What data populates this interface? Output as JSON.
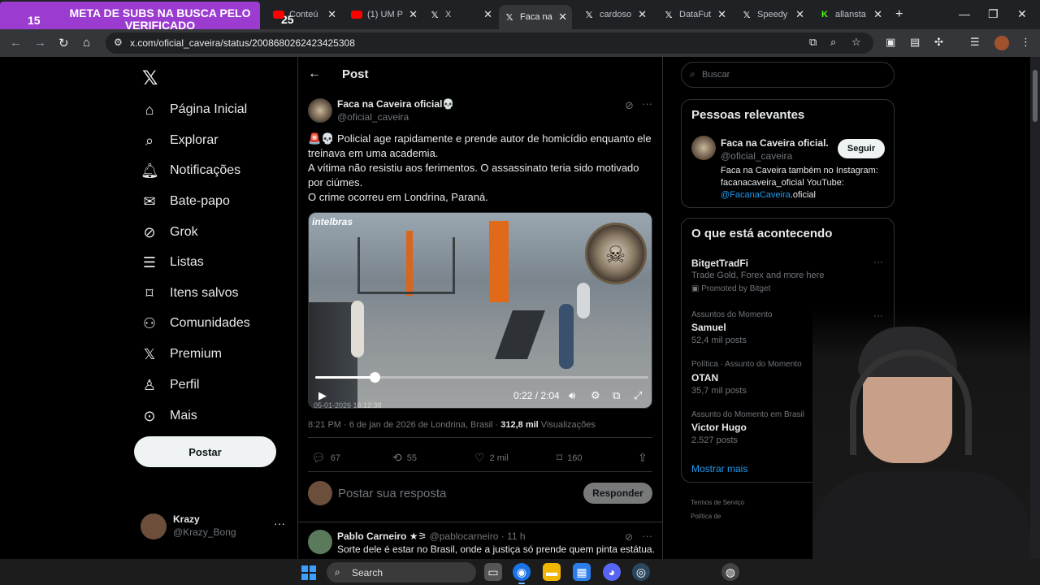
{
  "overlay": {
    "counter_left": "15",
    "banner": "META DE SUBS NA BUSCA PELO VERIFICADO",
    "counter_right": "25"
  },
  "tabs": [
    {
      "label": "Conteú",
      "icon": "youtube-icon"
    },
    {
      "label": "(1) UM P",
      "icon": "youtube-icon"
    },
    {
      "label": "X",
      "icon": "x-icon"
    },
    {
      "label": "Faca na",
      "icon": "x-icon",
      "active": true
    },
    {
      "label": "cardoso",
      "icon": "x-icon"
    },
    {
      "label": "DataFut",
      "icon": "x-icon"
    },
    {
      "label": "Speedy",
      "icon": "x-icon"
    },
    {
      "label": "allansta",
      "icon": "kick-icon"
    }
  ],
  "address": {
    "url": "x.com/oficial_caveira/status/2008680262423425308"
  },
  "nav": {
    "items": [
      {
        "label": "Página Inicial",
        "icon": "home-icon"
      },
      {
        "label": "Explorar",
        "icon": "search-icon"
      },
      {
        "label": "Notificações",
        "icon": "bell-icon"
      },
      {
        "label": "Bate-papo",
        "icon": "mail-icon"
      },
      {
        "label": "Grok",
        "icon": "grok-icon"
      },
      {
        "label": "Listas",
        "icon": "list-icon"
      },
      {
        "label": "Itens salvos",
        "icon": "bookmark-icon"
      },
      {
        "label": "Comunidades",
        "icon": "communities-icon"
      },
      {
        "label": "Premium",
        "icon": "x-premium-icon"
      },
      {
        "label": "Perfil",
        "icon": "person-icon"
      },
      {
        "label": "Mais",
        "icon": "more-circle-icon"
      }
    ],
    "post_button": "Postar",
    "me": {
      "name": "Krazy",
      "handle": "@Krazy_Bong"
    }
  },
  "post": {
    "header_title": "Post",
    "author_name": "Faca na Caveira oficial💀",
    "author_handle": "@oficial_caveira",
    "text_lines": [
      "🚨💀 Policial age rapidamente e prende autor de homicídio enquanto ele treinava em uma academia.",
      "A vítima não resistiu aos ferimentos. O assassinato teria sido motivado por ciúmes.",
      "O crime ocorreu em Londrina, Paraná."
    ],
    "video": {
      "watermark": "intelbras",
      "overlay_date": "05-01-2026 16:12:38",
      "time": "0:22 / 2:04",
      "progress": 0.1774
    },
    "meta_time": "8:21 PM · 6 de jan de 2026 de Londrina, Brasil · ",
    "meta_views": "312,8 mil",
    "meta_views_label": " Visualizações",
    "stats": {
      "replies": "67",
      "reposts": "55",
      "likes": "2 mil",
      "bookmarks": "160"
    },
    "reply_placeholder": "Postar sua resposta",
    "reply_button": "Responder"
  },
  "comment": {
    "name": "Pablo Carneiro ★⚞",
    "handle": "@pablocarneiro",
    "time": "· 11 h",
    "text": "Sorte dele é estar no Brasil, onde a justiça só prende quem pinta estátua."
  },
  "sidebar": {
    "search_placeholder": "Buscar",
    "relevant": {
      "title": "Pessoas relevantes",
      "name": "Faca na Caveira oficial...",
      "handle": "@oficial_caveira",
      "follow": "Seguir",
      "bio": "Faca na Caveira também no Instagram: facanacaveira_oficial YouTube: ",
      "bio_link": "@FacanaCaveira",
      "bio_end": ".oficial"
    },
    "trending": {
      "title": "O que está acontecendo",
      "items": [
        {
          "category": "",
          "name": "BitgetTradFi",
          "sub": "Trade Gold, Forex and more here",
          "promo": "Promoted by Bitget"
        },
        {
          "category": "Assuntos do Momento",
          "name": "Samuel",
          "sub": "52,4 mil posts"
        },
        {
          "category": "Política · Assunto do Momento",
          "name": "OTAN",
          "sub": "35,7 mil posts"
        },
        {
          "category": "Assunto do Momento em Brasil",
          "name": "Victor Hugo",
          "sub": "2.527 posts"
        }
      ],
      "show_more": "Mostrar mais"
    },
    "footer": {
      "terms": "Termos de Serviço",
      "privacy": "Política de"
    }
  },
  "taskbar": {
    "search_label": "Search"
  }
}
